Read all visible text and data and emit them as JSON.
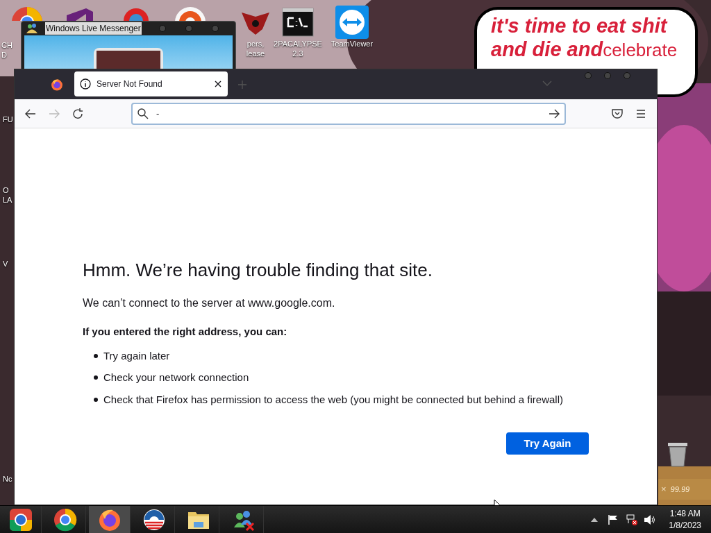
{
  "desktop": {
    "icons": [
      {
        "kind": "chrome",
        "lines": [
          "CH",
          "D"
        ]
      },
      {
        "kind": "studio"
      },
      {
        "kind": "ring"
      },
      {
        "kind": "disc"
      },
      {
        "kind": "shield",
        "lines": [
          "pers,",
          "lease"
        ]
      },
      {
        "kind": "console",
        "lines": [
          "2PACALYPSE",
          "2.3"
        ]
      },
      {
        "kind": "teamviewer",
        "lines": [
          "TeamViewer"
        ]
      }
    ],
    "edge_texts": [
      "FU",
      "O",
      "LA",
      "V",
      "Nc"
    ]
  },
  "bubble": {
    "lines": [
      {
        "runs": [
          {
            "text": "it's time to eat shit",
            "kind": "shout"
          }
        ]
      },
      {
        "runs": [
          {
            "text": "and die and",
            "kind": "shout"
          },
          {
            "text": "celebrate",
            "kind": "plain"
          }
        ]
      }
    ]
  },
  "messenger": {
    "title": "Windows Live Messenger"
  },
  "browser": {
    "tabs": [
      {
        "title": "Server Not Found",
        "selected": true
      }
    ],
    "address": {
      "value": "-"
    },
    "error": {
      "heading": "Hmm. We’re having trouble finding that site.",
      "message": "We can’t connect to the server at www.google.com.",
      "subheading": "If you entered the right address, you can:",
      "bullets": [
        "Try again later",
        "Check your network connection",
        "Check that Firefox has permission to access the web (you might be connected but behind a firewall)"
      ],
      "button": "Try Again"
    }
  },
  "widget": {
    "close": "×",
    "value": "99.99"
  },
  "taskbar": {
    "apps": [
      {
        "kind": "chrome-old",
        "selected": false
      },
      {
        "kind": "chrome",
        "selected": false
      },
      {
        "kind": "firefox",
        "selected": true
      },
      {
        "kind": "logo",
        "selected": false
      },
      {
        "kind": "folder",
        "selected": false
      },
      {
        "kind": "messenger",
        "selected": false
      }
    ],
    "clock": {
      "time": "1:48 AM",
      "date": "1/8/2023"
    }
  }
}
